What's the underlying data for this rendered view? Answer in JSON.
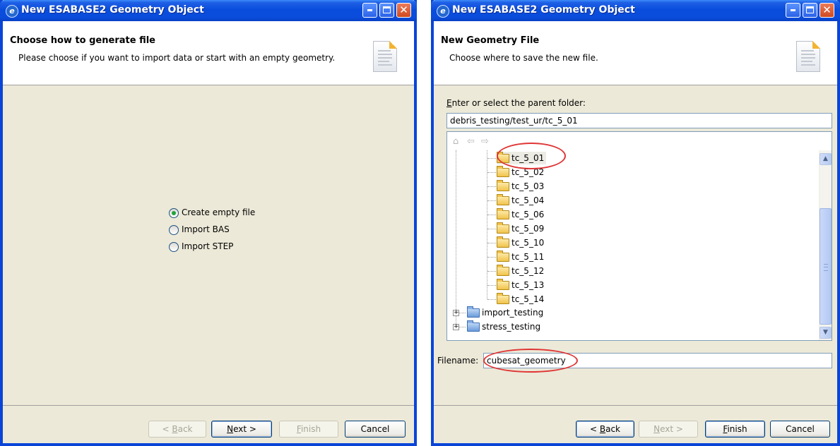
{
  "window_title": "New ESABASE2 Geometry Object",
  "dialog1": {
    "header_title": "Choose how to generate file",
    "header_desc": "Please choose if you want to import data or start with an empty geometry.",
    "options": [
      {
        "label": "Create empty file",
        "selected": true
      },
      {
        "label": "Import BAS",
        "selected": false
      },
      {
        "label": "Import STEP",
        "selected": false
      }
    ],
    "buttons": {
      "back_prefix": "< ",
      "back_u": "B",
      "back_rest": "ack",
      "next_u": "N",
      "next_rest": "ext >",
      "finish_u": "F",
      "finish_rest": "inish",
      "cancel": "Cancel"
    }
  },
  "dialog2": {
    "header_title": "New Geometry File",
    "header_desc": "Choose where to save the new file.",
    "parent_label_u": "E",
    "parent_label_rest": "nter or select the parent folder:",
    "parent_value": "debris_testing/test_ur/tc_5_01",
    "tree_children": [
      "tc_5_01",
      "tc_5_02",
      "tc_5_03",
      "tc_5_04",
      "tc_5_06",
      "tc_5_09",
      "tc_5_10",
      "tc_5_11",
      "tc_5_12",
      "tc_5_13",
      "tc_5_14"
    ],
    "tree_roots": [
      "import_testing",
      "stress_testing"
    ],
    "filename_label": "Filename:",
    "filename_value": "cubesat_geometry",
    "buttons": {
      "back_prefix": "< ",
      "back_u": "B",
      "back_rest": "ack",
      "next_u": "N",
      "next_rest": "ext >",
      "finish_u": "F",
      "finish_rest": "inish",
      "cancel": "Cancel"
    }
  },
  "colors": {
    "title_bar": "#0a4ddc",
    "annotation": "#e03535",
    "window_bg": "#ece9d8"
  },
  "icons": {
    "app": "eclipse-icon",
    "minimize": "minimize-icon",
    "maximize": "maximize-icon",
    "close": "close-icon",
    "document": "document-icon",
    "folder": "folder-icon",
    "home": "home-icon",
    "back": "back-arrow-icon",
    "forward": "forward-arrow-icon"
  }
}
